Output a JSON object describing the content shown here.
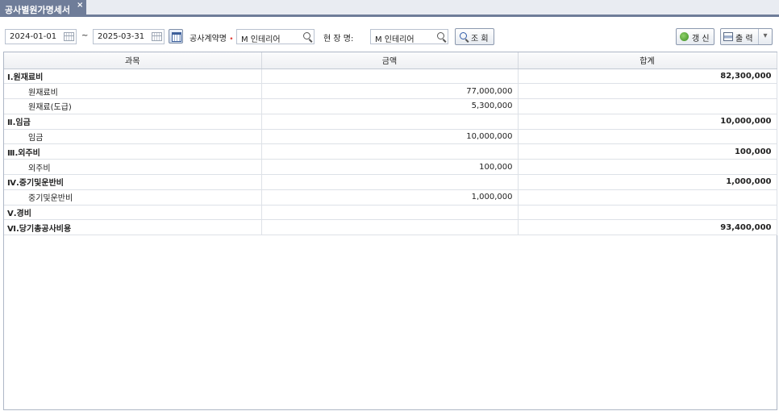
{
  "tab": {
    "title": "공사별원가명세서",
    "close": "×"
  },
  "filters": {
    "start_date": "2024-01-01",
    "range_sep": "~",
    "end_date": "2025-03-31",
    "contract_label": "공사계약명",
    "required_mark": "•",
    "contract_value": "M 인테리어",
    "site_label": "현 장 명:",
    "site_value": "M 인테리어",
    "search_label": "조 회"
  },
  "toolbar": {
    "refresh_label": "갱 신",
    "print_label": "출 력",
    "dropdown": "▾"
  },
  "grid": {
    "headers": [
      "과목",
      "금액",
      "합계"
    ],
    "rows": [
      {
        "type": "cat",
        "name": "Ⅰ.원재료비",
        "amount": "",
        "total": "82,300,000"
      },
      {
        "type": "item",
        "name": "원재료비",
        "amount": "77,000,000",
        "total": ""
      },
      {
        "type": "item",
        "name": "원재료(도급)",
        "amount": "5,300,000",
        "total": ""
      },
      {
        "type": "cat",
        "name": "Ⅱ.임금",
        "amount": "",
        "total": "10,000,000"
      },
      {
        "type": "item",
        "name": "임금",
        "amount": "10,000,000",
        "total": ""
      },
      {
        "type": "cat",
        "name": "Ⅲ.외주비",
        "amount": "",
        "total": "100,000"
      },
      {
        "type": "item",
        "name": "외주비",
        "amount": "100,000",
        "total": ""
      },
      {
        "type": "cat",
        "name": "Ⅳ.중기및운반비",
        "amount": "",
        "total": "1,000,000"
      },
      {
        "type": "item",
        "name": "중기및운반비",
        "amount": "1,000,000",
        "total": ""
      },
      {
        "type": "cat",
        "name": "Ⅴ.경비",
        "amount": "",
        "total": ""
      },
      {
        "type": "cat",
        "name": "Ⅵ.당기총공사비용",
        "amount": "",
        "total": "93,400,000"
      }
    ]
  },
  "colors": {
    "accent": "#6f7d99",
    "required": "#e0403a"
  }
}
